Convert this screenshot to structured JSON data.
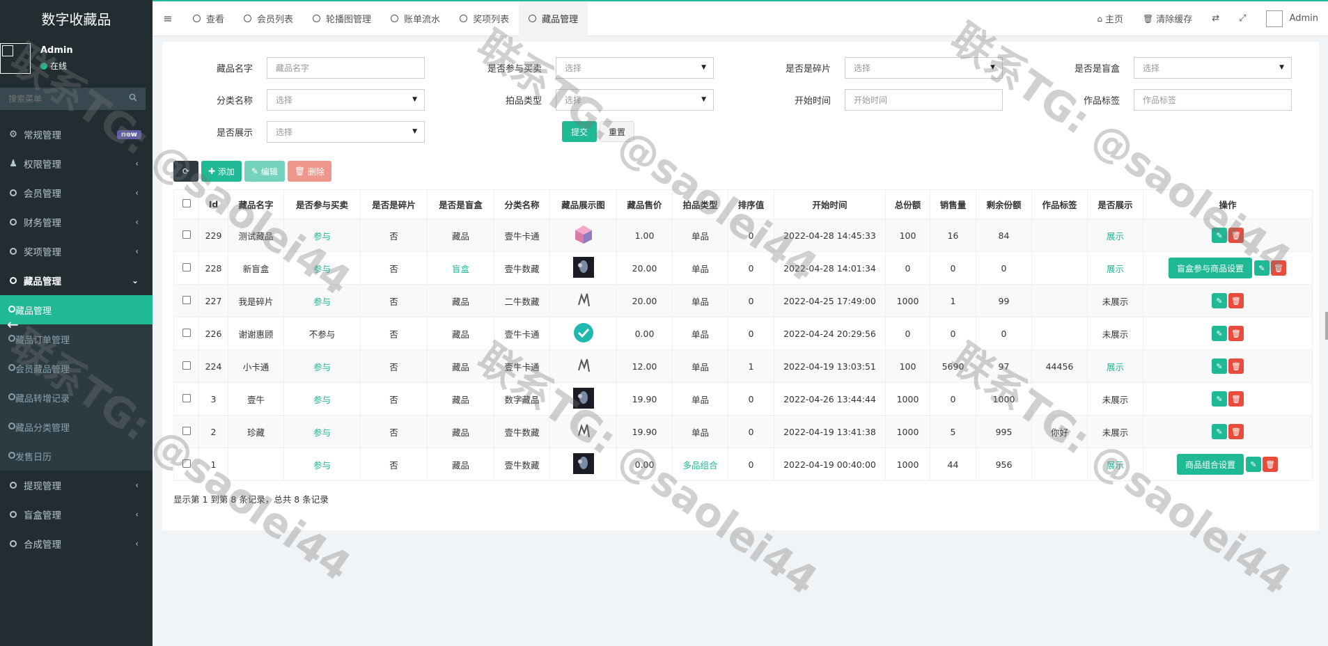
{
  "sidebar": {
    "brand": "数字收藏品",
    "user": {
      "name": "Admin",
      "status": "在线"
    },
    "search_placeholder": "搜索菜单",
    "menu": [
      {
        "label": "常规管理",
        "badge": "new",
        "icon": "cogs-icon"
      },
      {
        "label": "权限管理",
        "arrow": "‹",
        "icon": "users-icon"
      },
      {
        "label": "会员管理",
        "arrow": "‹"
      },
      {
        "label": "财务管理",
        "arrow": "‹"
      },
      {
        "label": "奖项管理",
        "arrow": "‹"
      },
      {
        "label": "藏品管理",
        "arrow": "⌄"
      }
    ],
    "submenu": [
      "藏品管理",
      "藏品订单管理",
      "会员藏品管理",
      "藏品转增记录",
      "藏品分类管理",
      "发售日历"
    ],
    "menu_after": [
      {
        "label": "提现管理",
        "arrow": "‹"
      },
      {
        "label": "盲盒管理",
        "arrow": "‹"
      },
      {
        "label": "合成管理",
        "arrow": "‹"
      }
    ]
  },
  "topnav": {
    "tabs": [
      "查看",
      "会员列表",
      "轮播图管理",
      "账单流水",
      "奖项列表",
      "藏品管理"
    ],
    "right": {
      "home": "主页",
      "clear_cache": "清除缓存",
      "admin": "Admin"
    }
  },
  "filters": {
    "name_label": "藏品名字",
    "name_placeholder": "藏品名字",
    "trade_label": "是否参与买卖",
    "trade_value": "选择",
    "fragment_label": "是否是碎片",
    "fragment_value": "选择",
    "blindbox_label": "是否是盲盒",
    "blindbox_value": "选择",
    "category_label": "分类名称",
    "category_value": "选择",
    "auction_label": "拍品类型",
    "auction_value": "选择",
    "start_label": "开始时间",
    "start_placeholder": "开始时间",
    "tag_label": "作品标签",
    "tag_placeholder": "作品标签",
    "show_label": "是否展示",
    "show_value": "选择",
    "submit": "提交",
    "reset": "重置"
  },
  "toolbar": {
    "add": "添加",
    "edit": "编辑",
    "delete": "删除"
  },
  "table": {
    "headers": [
      "Id",
      "藏品名字",
      "是否参与买卖",
      "是否是碎片",
      "是否是盲盒",
      "分类名称",
      "藏品展示图",
      "藏品售价",
      "拍品类型",
      "排序值",
      "开始时间",
      "总份额",
      "销售量",
      "剩余份额",
      "作品标签",
      "是否展示",
      "操作"
    ],
    "rows": [
      {
        "id": "229",
        "name": "测试藏品",
        "trade": "参与",
        "frag": "否",
        "box": "藏品",
        "cat": "壹牛卡通",
        "img": "cube",
        "price": "1.00",
        "type": "单品",
        "sort": "0",
        "start": "2022-04-28 14:45:33",
        "total": "100",
        "sold": "16",
        "left": "84",
        "tag": "",
        "show": "展示",
        "extra": ""
      },
      {
        "id": "228",
        "name": "新盲盒",
        "trade": "参与",
        "frag": "否",
        "box": "盲盒",
        "cat": "壹牛数藏",
        "img": "dark",
        "price": "20.00",
        "type": "单品",
        "sort": "0",
        "start": "2022-04-28 14:01:34",
        "total": "0",
        "sold": "0",
        "left": "0",
        "tag": "",
        "show": "展示",
        "extra": "盲盒参与商品设置"
      },
      {
        "id": "227",
        "name": "我是碎片",
        "trade": "参与",
        "frag": "否",
        "box": "藏品",
        "cat": "二牛数藏",
        "img": "sketch",
        "price": "20.00",
        "type": "单品",
        "sort": "0",
        "start": "2022-04-25 17:49:00",
        "total": "1000",
        "sold": "1",
        "left": "99",
        "tag": "",
        "show": "未展示",
        "extra": ""
      },
      {
        "id": "226",
        "name": "谢谢惠顾",
        "trade": "不参与",
        "frag": "否",
        "box": "藏品",
        "cat": "壹牛卡通",
        "img": "check",
        "price": "0.00",
        "type": "单品",
        "sort": "0",
        "start": "2022-04-24 20:29:56",
        "total": "0",
        "sold": "0",
        "left": "0",
        "tag": "",
        "show": "未展示",
        "extra": ""
      },
      {
        "id": "224",
        "name": "小卡通",
        "trade": "参与",
        "frag": "否",
        "box": "藏品",
        "cat": "壹牛卡通",
        "img": "sketch",
        "price": "12.00",
        "type": "单品",
        "sort": "1",
        "start": "2022-04-19 13:03:51",
        "total": "100",
        "sold": "5690",
        "left": "97",
        "tag": "44456",
        "show": "展示",
        "extra": ""
      },
      {
        "id": "3",
        "name": "壹牛",
        "trade": "参与",
        "frag": "否",
        "box": "藏品",
        "cat": "数字藏品",
        "img": "dark",
        "price": "19.90",
        "type": "单品",
        "sort": "0",
        "start": "2022-04-26 13:44:44",
        "total": "1000",
        "sold": "0",
        "left": "1000",
        "tag": "",
        "show": "未展示",
        "extra": ""
      },
      {
        "id": "2",
        "name": "珍藏",
        "trade": "参与",
        "frag": "否",
        "box": "藏品",
        "cat": "壹牛数藏",
        "img": "sketch",
        "price": "19.90",
        "type": "单品",
        "sort": "0",
        "start": "2022-04-19 13:41:38",
        "total": "1000",
        "sold": "5",
        "left": "995",
        "tag": "你好",
        "show": "未展示",
        "extra": ""
      },
      {
        "id": "1",
        "name": "",
        "trade": "参与",
        "frag": "否",
        "box": "藏品",
        "cat": "壹牛数藏",
        "img": "dark",
        "price": "0.00",
        "type": "多品组合",
        "sort": "0",
        "start": "2022-04-19 00:40:00",
        "total": "1000",
        "sold": "44",
        "left": "956",
        "tag": "",
        "show": "展示",
        "extra": "商品组合设置"
      }
    ]
  },
  "pager_info": "显示第 1 到第 8 条记录，总共 8 条记录",
  "watermark": "联系TG: @saolei44",
  "colors": {
    "accent": "#1fb995",
    "sidebar": "#222d32",
    "danger": "#e74c3c"
  }
}
